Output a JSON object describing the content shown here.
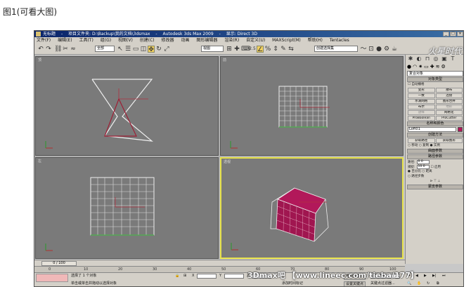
{
  "caption": "图1(可看大图)",
  "window": {
    "title_parts": [
      "无标题",
      "项目文件夹: D:\\Backup\\我的文档\\3dsmax",
      "Autodesk 3ds Max 2009",
      "显示: Direct 3D"
    ]
  },
  "menu": [
    "文件(F)",
    "编辑(E)",
    "工具(T)",
    "组(G)",
    "视图(V)",
    "创建(C)",
    "修改器",
    "动画",
    "图形编辑器",
    "渲染(R)",
    "自定义(U)",
    "MAXScript(M)",
    "帮助(H)",
    "Tentacles"
  ],
  "toolbar": {
    "selection_filter": "全部",
    "ref_coord": "视图",
    "named_selection": "创建选择集",
    "snap_value": "2.5"
  },
  "logo": "火星时代",
  "viewports": {
    "top": "顶",
    "front": "前",
    "left": "左",
    "perspective": "透视"
  },
  "command_panel": {
    "category": "复合对象",
    "object_type_rollout": "对象类型",
    "auto_grid": "自动栅格",
    "buttons": [
      "变形",
      "散布",
      "一致",
      "连接",
      "水滴网格",
      "图形合并",
      "布尔",
      "地形",
      "放样",
      "网格化",
      "ProBoolean",
      "ProCutter"
    ],
    "name_color_rollout": "名称和颜色",
    "object_name": "Loft01",
    "creation_method_rollout": "创建方法",
    "get_path": "获取路径",
    "get_shape": "获取图形",
    "move": "移动",
    "copy": "复制",
    "instance": "实例",
    "surface_params_rollout": "曲面参数",
    "path_params_rollout": "路径参数",
    "path_label": "路径:",
    "path_value": "0.0",
    "snap_label": "捕捉:",
    "snap_value": "10.0",
    "enable_label": "启用",
    "percentage": "百分比",
    "distance": "距离",
    "path_steps": "路径步数",
    "skin_params_rollout": "蒙皮参数"
  },
  "timeline": {
    "slider": "0 / 100",
    "ticks": [
      "0",
      "10",
      "20",
      "30",
      "40",
      "50",
      "60",
      "70",
      "80",
      "90",
      "100"
    ]
  },
  "status": {
    "selected": "选择了 1 个对象",
    "prompt": "单击或单击并拖动以选择对象",
    "add_time_tag": "添加时间标记",
    "x_label": "X",
    "y_label": "Y",
    "z_label": "Z",
    "auto_key": "自动关键点",
    "set_key": "设置关键点",
    "key_filter": "关键点过滤器...",
    "selected_object": "选定对象"
  },
  "watermark": "3Dmax吧 【www.lineec.com/tieba/177】"
}
